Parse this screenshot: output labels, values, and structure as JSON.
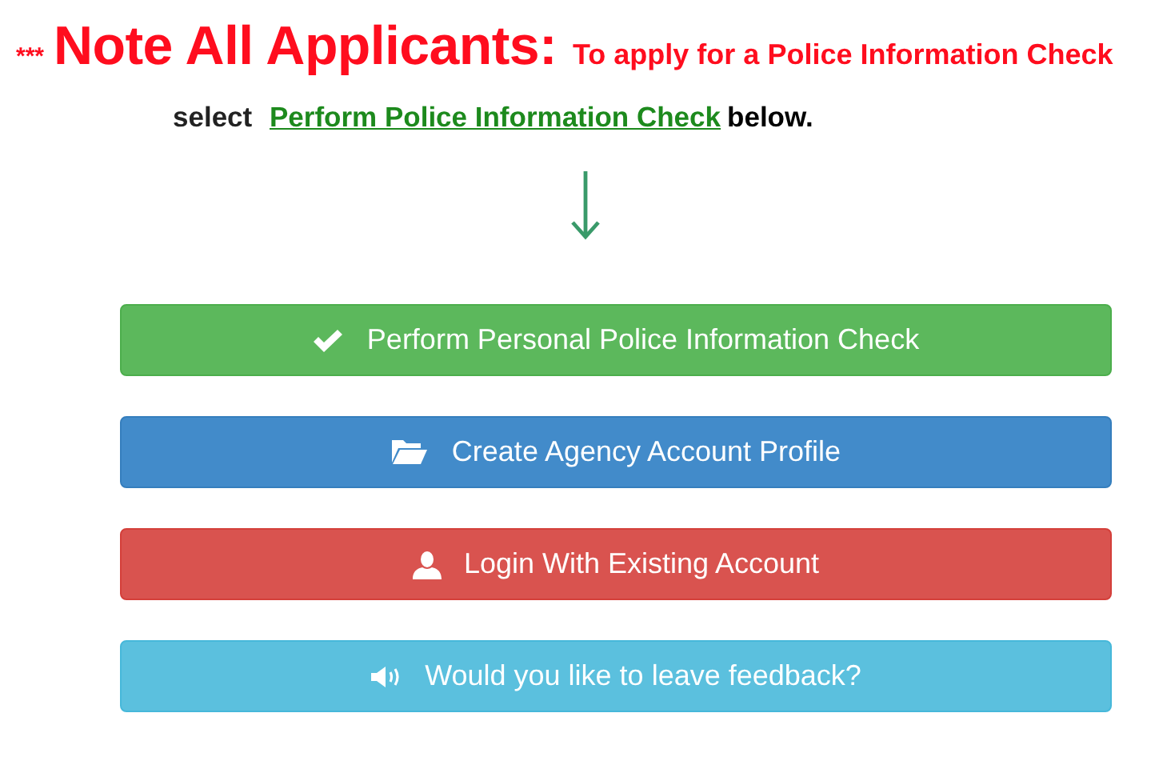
{
  "notice": {
    "stars": "***",
    "heading": "Note All Applicants:",
    "instruction": "To apply for a Police Information Check",
    "line_start": "select",
    "link": "Perform Police Information Check",
    "line_end": "below."
  },
  "buttons": [
    {
      "kind": "success",
      "label": "Perform Personal Police Information Check"
    },
    {
      "kind": "primary",
      "label": "Create Agency Account Profile"
    },
    {
      "kind": "danger",
      "label": "Login With Existing Account"
    },
    {
      "kind": "info",
      "label": "Would you like to leave feedback?"
    }
  ]
}
